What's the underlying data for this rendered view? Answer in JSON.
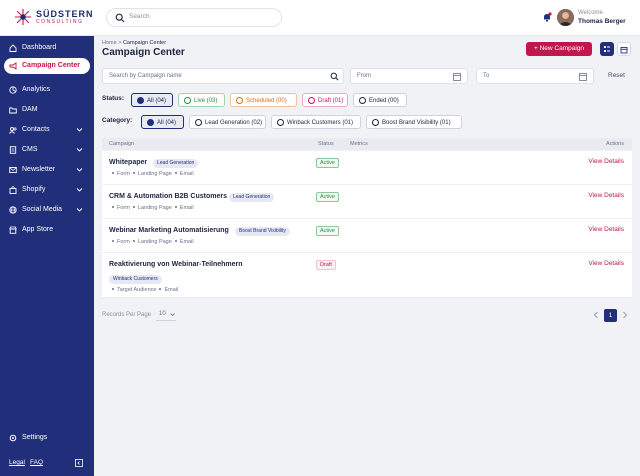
{
  "header": {
    "brand": "SÜDSTERN",
    "brand_sub": "CONSULTING",
    "search_placeholder": "Search",
    "welcome": "Welcome",
    "user_name": "Thomas Berger"
  },
  "sidebar": {
    "items": [
      {
        "label": "Dashboard",
        "icon": "home-icon",
        "active": false,
        "expandable": false
      },
      {
        "label": "Campaign Center",
        "icon": "megaphone-icon",
        "active": true,
        "expandable": false
      },
      {
        "label": "Analytics",
        "icon": "analytics-icon",
        "active": false,
        "expandable": false
      },
      {
        "label": "DAM",
        "icon": "folder-icon",
        "active": false,
        "expandable": false
      },
      {
        "label": "Contacts",
        "icon": "contacts-icon",
        "active": false,
        "expandable": true
      },
      {
        "label": "CMS",
        "icon": "document-icon",
        "active": false,
        "expandable": true
      },
      {
        "label": "Newsletter",
        "icon": "mail-icon",
        "active": false,
        "expandable": true
      },
      {
        "label": "Shopify",
        "icon": "shopping-bag-icon",
        "active": false,
        "expandable": true
      },
      {
        "label": "Social Media",
        "icon": "globe-icon",
        "active": false,
        "expandable": true
      },
      {
        "label": "App Store",
        "icon": "store-icon",
        "active": false,
        "expandable": false
      }
    ],
    "settings": "Settings",
    "legal": "Legal",
    "faq": "FAQ"
  },
  "main": {
    "breadcrumb_home": "Home",
    "breadcrumb_sep": ">",
    "breadcrumb_current": "Campaign Center",
    "title": "Campaign Center",
    "new_campaign": "+ New Campaign",
    "search_placeholder": "Search by Campaign name",
    "from_placeholder": "From",
    "to_placeholder": "To",
    "reset": "Reset",
    "status_label": "Status:",
    "status_filters": [
      {
        "label": "All (04)",
        "tone": "selected"
      },
      {
        "label": "Live (03)",
        "tone": "green"
      },
      {
        "label": "Scheduled (00)",
        "tone": "orange"
      },
      {
        "label": "Draft (01)",
        "tone": "red"
      },
      {
        "label": "Ended (00)",
        "tone": "plain"
      }
    ],
    "category_label": "Category:",
    "category_filters": [
      {
        "label": "All (04)",
        "tone": "selected"
      },
      {
        "label": "Lead Generation (02)",
        "tone": "plain"
      },
      {
        "label": "Winback Customers (01)",
        "tone": "plain"
      },
      {
        "label": "Boost Brand Visibility (01)",
        "tone": "plain"
      }
    ],
    "table": {
      "headers": {
        "campaign": "Campaign",
        "status": "Status",
        "metrics": "Metrics",
        "actions": "Actions"
      },
      "rows": [
        {
          "name": "Whitepaper",
          "tag": "Lead Generation",
          "meta": [
            "Form",
            "Landing Page",
            "Email"
          ],
          "status": "Active",
          "status_tone": "active",
          "action": "View Details"
        },
        {
          "name": "CRM & Automation B2B Customers",
          "tag": "Lead Generation",
          "meta": [
            "Form",
            "Landing Page",
            "Email"
          ],
          "status": "Active",
          "status_tone": "active",
          "action": "View Details"
        },
        {
          "name": "Webinar Marketing Automatisierung",
          "tag": "Boost Brand Visibility",
          "meta": [
            "Form",
            "Landing Page",
            "Email"
          ],
          "status": "Active",
          "status_tone": "active",
          "action": "View Details"
        },
        {
          "name": "Reaktivierung von Webinar-Teilnehmern",
          "tag": "Winback Customers",
          "meta": [
            "Target Audience",
            "Email"
          ],
          "status": "Draft",
          "status_tone": "draft",
          "action": "View Details"
        }
      ]
    },
    "records_per_page_label": "Records Per Page",
    "records_per_page": "10",
    "current_page": "1"
  },
  "colors": {
    "sidebar": "#212f7a",
    "accent": "#c1174f",
    "background": "#f1f2f6"
  }
}
